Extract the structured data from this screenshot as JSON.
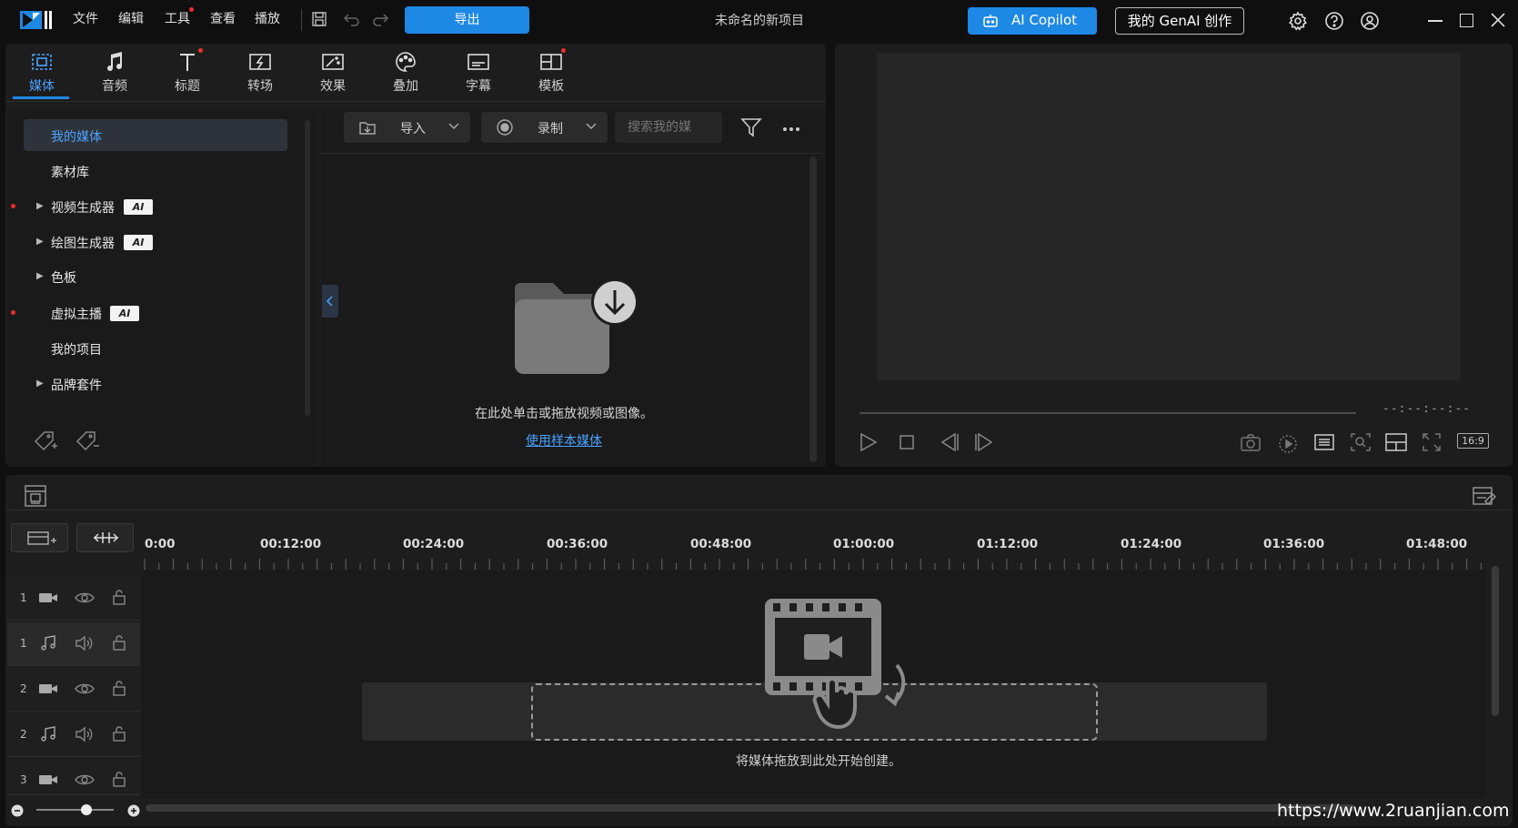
{
  "app": {
    "project_title": "未命名的新项目",
    "menu": [
      "文件",
      "编辑",
      "工具",
      "查看",
      "播放"
    ],
    "export_label": "导出",
    "copilot_label": "AI Copilot",
    "genai_label": "我的 GenAI 创作",
    "accent_color": "#1e88e5"
  },
  "tabs": [
    {
      "label": "媒体",
      "icon": "media-icon",
      "active": true
    },
    {
      "label": "音频",
      "icon": "music-note-icon"
    },
    {
      "label": "标题",
      "icon": "text-icon"
    },
    {
      "label": "转场",
      "icon": "transition-icon"
    },
    {
      "label": "效果",
      "icon": "effects-icon"
    },
    {
      "label": "叠加",
      "icon": "overlay-icon"
    },
    {
      "label": "字幕",
      "icon": "subtitle-icon"
    },
    {
      "label": "模板",
      "icon": "template-icon"
    }
  ],
  "library": {
    "items": [
      {
        "label": "我的媒体"
      },
      {
        "label": "素材库"
      },
      {
        "label": "视频生成器",
        "ai": "AI"
      },
      {
        "label": "绘图生成器",
        "ai": "AI"
      },
      {
        "label": "色板"
      },
      {
        "label": "虚拟主播",
        "ai": "AI"
      },
      {
        "label": "我的项目"
      },
      {
        "label": "品牌套件"
      }
    ]
  },
  "media": {
    "import_label": "导入",
    "record_label": "录制",
    "search_placeholder": "搜索我的媒",
    "empty_text": "在此处单击或拖放视频或图像。",
    "sample_link": "使用样本媒体"
  },
  "preview": {
    "timecode": "--:--:--:--",
    "aspect_ratio": "16:9"
  },
  "timeline": {
    "ruler": [
      "0:00",
      "00:12:00",
      "00:24:00",
      "00:36:00",
      "00:48:00",
      "01:00:00",
      "01:12:00",
      "01:24:00",
      "01:36:00",
      "01:48:00"
    ],
    "tracks": [
      {
        "num": "1",
        "type": "video"
      },
      {
        "num": "1",
        "type": "audio"
      },
      {
        "num": "2",
        "type": "video"
      },
      {
        "num": "2",
        "type": "audio"
      },
      {
        "num": "3",
        "type": "video"
      }
    ],
    "drop_text": "将媒体拖放到此处开始创建。"
  },
  "watermark": "https://www.2ruanjian.com"
}
